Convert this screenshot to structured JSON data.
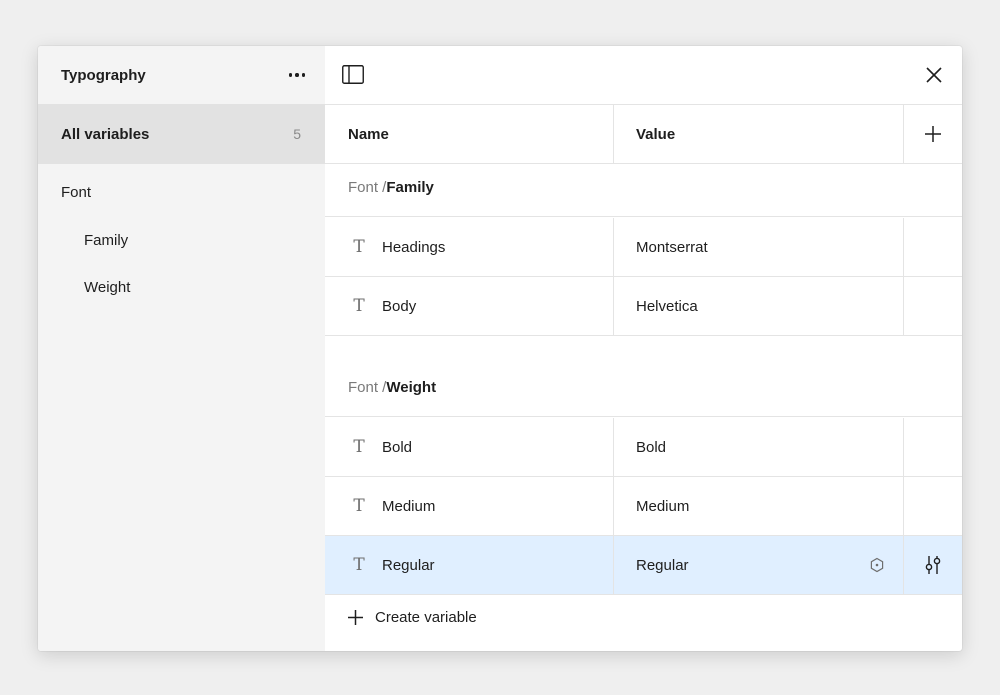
{
  "sidebar": {
    "title": "Typography",
    "all_variables": {
      "label": "All variables",
      "count": "5"
    },
    "group": "Font",
    "items": [
      {
        "label": "Family"
      },
      {
        "label": "Weight"
      }
    ]
  },
  "table": {
    "headers": {
      "name": "Name",
      "value": "Value"
    },
    "groups": [
      {
        "prefix": "Font / ",
        "name": "Family",
        "rows": [
          {
            "icon": "text-type-icon",
            "glyph": "T",
            "name": "Headings",
            "value": "Montserrat"
          },
          {
            "icon": "text-type-icon",
            "glyph": "T",
            "name": "Body",
            "value": "Helvetica"
          }
        ]
      },
      {
        "prefix": "Font / ",
        "name": "Weight",
        "rows": [
          {
            "icon": "text-type-icon",
            "glyph": "T",
            "name": "Bold",
            "value": "Bold"
          },
          {
            "icon": "text-type-icon",
            "glyph": "T",
            "name": "Medium",
            "value": "Medium"
          },
          {
            "icon": "text-type-icon",
            "glyph": "T",
            "name": "Regular",
            "value": "Regular",
            "selected": true
          }
        ]
      }
    ],
    "create_label": "Create variable"
  },
  "colors": {
    "selected_row": "#e0efff",
    "sidebar_bg": "#f4f4f4",
    "active_sidebar_item": "#e2e2e2"
  }
}
